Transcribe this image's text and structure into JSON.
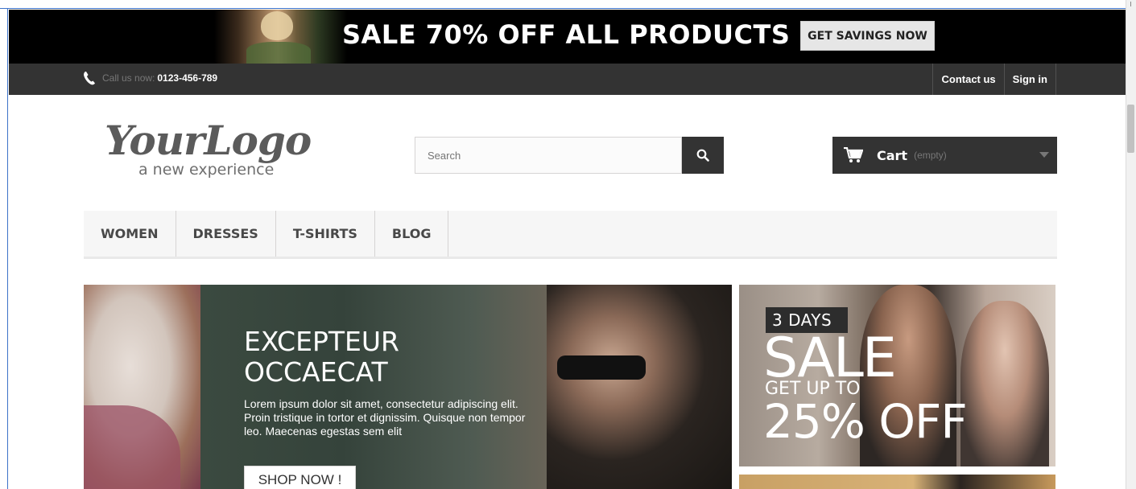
{
  "banner": {
    "title": "SALE 70% OFF ALL PRODUCTS",
    "button_label": "GET SAVINGS NOW"
  },
  "nav": {
    "phone_label": "Call us now:",
    "phone_number": "0123-456-789",
    "links": [
      "Contact us",
      "Sign in"
    ]
  },
  "header": {
    "logo_script": "YourLogo",
    "logo_tagline": "a new experience",
    "search_placeholder": "Search",
    "cart_label": "Cart",
    "cart_status": "(empty)"
  },
  "menu": {
    "items": [
      "WOMEN",
      "DRESSES",
      "T-SHIRTS",
      "BLOG"
    ]
  },
  "hero": {
    "title_line1": "EXCEPTEUR",
    "title_line2": "OCCAECAT",
    "text": "Lorem ipsum dolor sit amet, consectetur adipiscing elit. Proin tristique in tortor et dignissim. Quisque non tempor leo. Maecenas egestas sem elit",
    "button_label": "SHOP NOW !"
  },
  "promo": {
    "days": "3 DAYS",
    "sale": "SALE",
    "upto": "GET UP TO",
    "off": "25% OFF"
  },
  "colors": {
    "dark_bar": "#333333",
    "banner_bg": "#000000",
    "menu_bg": "#f6f6f6",
    "window_border": "#3d73c9"
  },
  "icons": {
    "phone": "phone-icon",
    "search": "search-icon",
    "cart": "cart-icon",
    "cart_toggle": "chevron-down-icon"
  }
}
